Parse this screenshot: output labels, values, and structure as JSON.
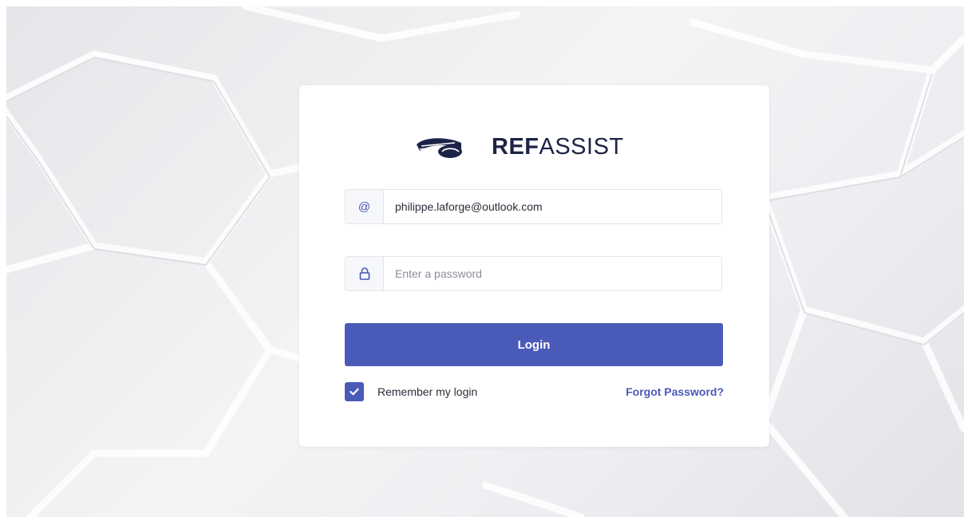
{
  "brand": {
    "name_bold": "REF",
    "name_light": "ASSIST",
    "logo_icon": "vehicle-wing-icon",
    "color": "#1c2346"
  },
  "form": {
    "email_icon": "@",
    "email_value": "philippe.laforge@outlook.com",
    "password_icon": "lock-icon",
    "password_placeholder": "Enter a password",
    "login_label": "Login",
    "remember_label": "Remember my login",
    "remember_checked": true,
    "forgot_label": "Forgot Password?"
  },
  "colors": {
    "accent": "#4a5ab8",
    "addon_bg": "#f6f7fb"
  }
}
